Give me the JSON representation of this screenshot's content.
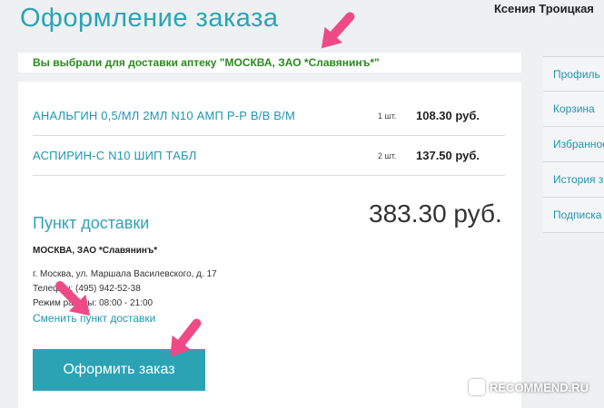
{
  "header": {
    "title": "Оформление заказа",
    "user_name": "Ксения Троицкая"
  },
  "notice": "Вы выбрали для доставки аптеку \"МОСКВА, ЗАО *Славянинъ*\"",
  "cart": {
    "items": [
      {
        "name": "АНАЛЬГИН 0,5/МЛ 2МЛ N10 АМП Р-Р В/В В/М",
        "qty": "1 шт.",
        "price": "108.30 руб."
      },
      {
        "name": "АСПИРИН-С N10 ШИП ТАБЛ",
        "qty": "2 шт.",
        "price": "137.50 руб."
      }
    ],
    "total": "383.30 руб."
  },
  "delivery": {
    "section_title": "Пункт доставки",
    "pharmacy_name": "МОСКВА, ЗАО *Славянинъ*",
    "address": "г. Москва, ул. Маршала Василевского, д. 17",
    "phone": "Телефон: (495) 942-52-38",
    "hours": "Режим работы: 08:00 - 21:00",
    "change_link": "Сменить пункт доставки"
  },
  "order_button": "Оформить заказ",
  "side_menu": [
    "Профиль",
    "Корзина",
    "Избранное",
    "История заказов",
    "Подписка"
  ],
  "watermark": "RECOMMEND.RU",
  "colors": {
    "accent": "#2ca3b5",
    "link": "#2196b0",
    "notice_green": "#2a8a1e",
    "arrow_pink": "#ee4b86"
  }
}
